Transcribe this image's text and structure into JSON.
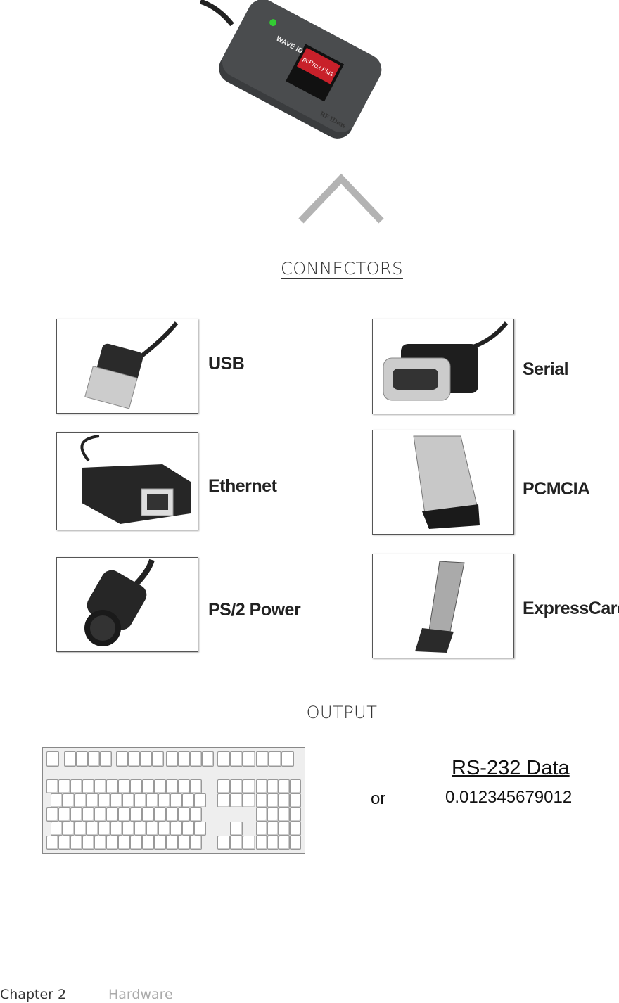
{
  "reader_image": {
    "brand": "WAVE ID",
    "product": "pcProx Plus",
    "maker": "RF IDeas"
  },
  "chevron_icon": "chevron-up-icon",
  "connectors": {
    "heading": "CONNECTORS",
    "items": [
      {
        "label": "USB"
      },
      {
        "label": "Serial"
      },
      {
        "label": "Ethernet"
      },
      {
        "label": "PCMCIA"
      },
      {
        "label": "PS/2 Power"
      },
      {
        "label": "ExpressCard"
      }
    ]
  },
  "output": {
    "heading": "OUTPUT",
    "or": "or",
    "rs232_title": "RS-232 Data",
    "rs232_value": "0.012345679012"
  },
  "footer": {
    "chapter": "Chapter 2",
    "section": "Hardware"
  }
}
